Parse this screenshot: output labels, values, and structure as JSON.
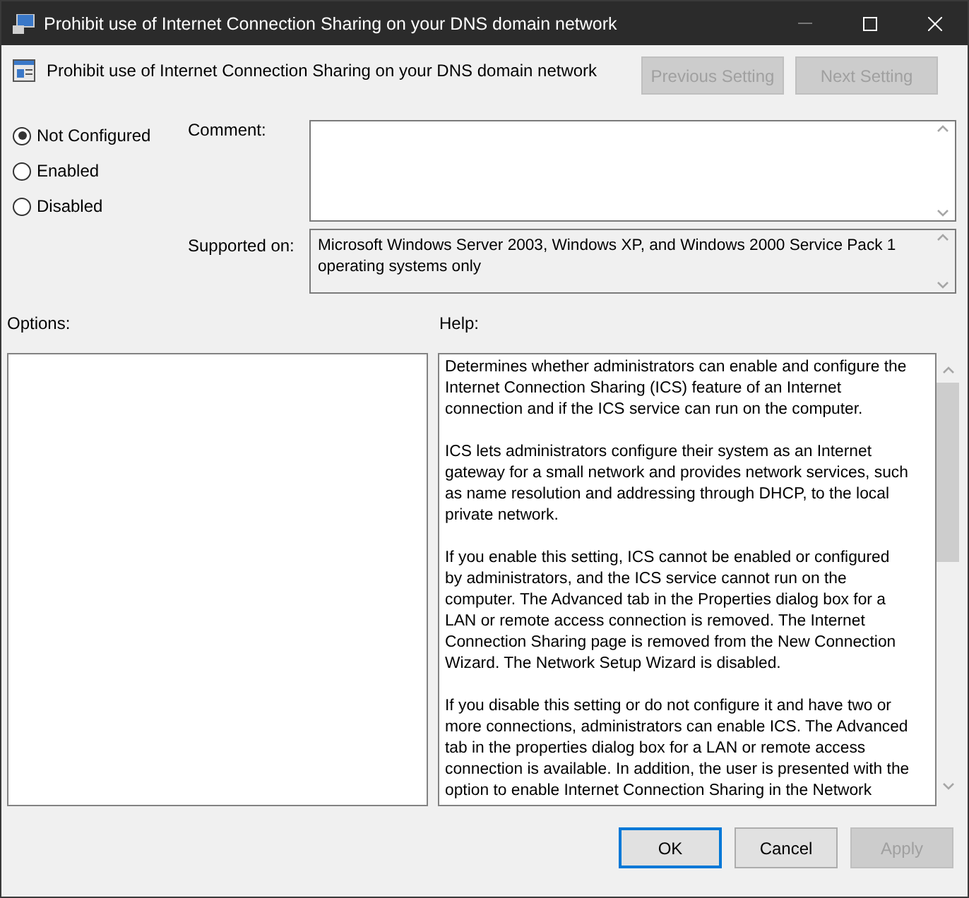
{
  "window": {
    "title": "Prohibit use of Internet Connection Sharing on your DNS domain network",
    "minimize_disabled": true
  },
  "header": {
    "title": "Prohibit use of Internet Connection Sharing on your DNS domain network",
    "buttons": [
      {
        "label": "Previous Setting",
        "disabled": true
      },
      {
        "label": "Next Setting",
        "disabled": true
      }
    ]
  },
  "state_options": [
    {
      "label": "Not Configured",
      "selected": true
    },
    {
      "label": "Enabled",
      "selected": false
    },
    {
      "label": "Disabled",
      "selected": false
    }
  ],
  "comment": {
    "label": "Comment:"
  },
  "supported_on": {
    "label": "Supported on:",
    "value": "Microsoft Windows Server 2003, Windows XP, and Windows 2000 Service Pack 1\noperating systems only"
  },
  "options": {
    "label": "Options:"
  },
  "help": {
    "label": "Help:",
    "paragraphs": [
      "Determines whether administrators can enable and configure the\nInternet Connection Sharing (ICS) feature of an Internet\nconnection and if the ICS service can run on the computer.",
      "ICS lets administrators configure their system as an Internet\ngateway for a small network and provides network services, such\nas name resolution and addressing through DHCP, to the local\nprivate network.",
      "If you enable this setting, ICS cannot be enabled or configured\nby administrators, and the ICS service cannot run on the\ncomputer. The Advanced tab in the Properties dialog box for a\nLAN or remote access connection is removed. The Internet\nConnection Sharing page is removed from the New Connection\nWizard. The Network Setup Wizard is disabled.",
      "If you disable this setting or do not configure it and have two or\nmore connections, administrators can enable ICS. The Advanced\ntab in the properties dialog box for a LAN or remote access\nconnection is available. In addition, the user is presented with the\noption to enable Internet Connection Sharing in the Network"
    ]
  },
  "footer_buttons": [
    {
      "label": "OK",
      "disabled": false,
      "default": true
    },
    {
      "label": "Cancel",
      "disabled": false,
      "default": false
    },
    {
      "label": "Apply",
      "disabled": true,
      "default": false
    }
  ]
}
